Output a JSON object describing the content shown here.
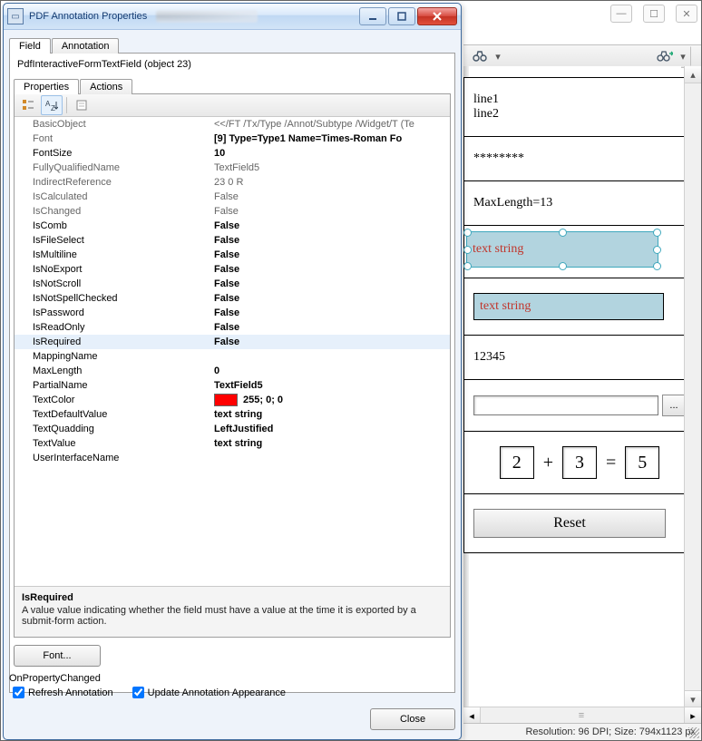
{
  "dialog": {
    "title": "PDF Annotation Properties",
    "tabs": {
      "field": "Field",
      "annotation": "Annotation"
    },
    "object_label": "PdfInteractiveFormTextField (object 23)",
    "inner_tabs": {
      "properties": "Properties",
      "actions": "Actions"
    },
    "props": {
      "BasicObject": {
        "k": "BasicObject",
        "v": "<</FT /Tx/Type /Annot/Subtype /Widget/T (Te",
        "bold": false
      },
      "Font": {
        "k": "Font",
        "v": "[9] Type=Type1 Name=Times-Roman Fo",
        "bold": true
      },
      "FontSize": {
        "k": "FontSize",
        "v": "10",
        "bold": true,
        "kbold": true
      },
      "FullyQualifiedName": {
        "k": "FullyQualifiedName",
        "v": "TextField5",
        "bold": false
      },
      "IndirectReference": {
        "k": "IndirectReference",
        "v": "23 0 R",
        "bold": false
      },
      "IsCalculated": {
        "k": "IsCalculated",
        "v": "False",
        "bold": false
      },
      "IsChanged": {
        "k": "IsChanged",
        "v": "False",
        "bold": false
      },
      "IsComb": {
        "k": "IsComb",
        "v": "False",
        "bold": true,
        "kbold": true
      },
      "IsFileSelect": {
        "k": "IsFileSelect",
        "v": "False",
        "bold": true,
        "kbold": true
      },
      "IsMultiline": {
        "k": "IsMultiline",
        "v": "False",
        "bold": true,
        "kbold": true
      },
      "IsNoExport": {
        "k": "IsNoExport",
        "v": "False",
        "bold": true,
        "kbold": true
      },
      "IsNotScroll": {
        "k": "IsNotScroll",
        "v": "False",
        "bold": true,
        "kbold": true
      },
      "IsNotSpellChecked": {
        "k": "IsNotSpellChecked",
        "v": "False",
        "bold": true,
        "kbold": true
      },
      "IsPassword": {
        "k": "IsPassword",
        "v": "False",
        "bold": true,
        "kbold": true
      },
      "IsReadOnly": {
        "k": "IsReadOnly",
        "v": "False",
        "bold": true,
        "kbold": true
      },
      "IsRequired": {
        "k": "IsRequired",
        "v": "False",
        "bold": true,
        "kbold": true,
        "selected": true
      },
      "MappingName": {
        "k": "MappingName",
        "v": "",
        "bold": true,
        "kbold": true
      },
      "MaxLength": {
        "k": "MaxLength",
        "v": "0",
        "bold": true,
        "kbold": true
      },
      "PartialName": {
        "k": "PartialName",
        "v": "TextField5",
        "bold": true,
        "kbold": true
      },
      "TextColor": {
        "k": "TextColor",
        "v": "255; 0; 0",
        "bold": true,
        "kbold": true,
        "swatch": "#ff0000"
      },
      "TextDefaultValue": {
        "k": "TextDefaultValue",
        "v": "text string",
        "bold": true,
        "kbold": true
      },
      "TextQuadding": {
        "k": "TextQuadding",
        "v": "LeftJustified",
        "bold": true,
        "kbold": true
      },
      "TextValue": {
        "k": "TextValue",
        "v": "text string",
        "bold": true,
        "kbold": true
      },
      "UserInterfaceName": {
        "k": "UserInterfaceName",
        "v": "",
        "bold": true,
        "kbold": true
      }
    },
    "prop_order": [
      "BasicObject",
      "Font",
      "FontSize",
      "FullyQualifiedName",
      "IndirectReference",
      "IsCalculated",
      "IsChanged",
      "IsComb",
      "IsFileSelect",
      "IsMultiline",
      "IsNoExport",
      "IsNotScroll",
      "IsNotSpellChecked",
      "IsPassword",
      "IsReadOnly",
      "IsRequired",
      "MappingName",
      "MaxLength",
      "PartialName",
      "TextColor",
      "TextDefaultValue",
      "TextQuadding",
      "TextValue",
      "UserInterfaceName"
    ],
    "desc": {
      "title": "IsRequired",
      "text": "A value value indicating whether the field must have a value at the time it is exported by a submit-form action."
    },
    "font_button": "Font...",
    "on_prop_changed": "OnPropertyChanged",
    "refresh_annotation": "Refresh Annotation",
    "update_annotation": "Update Annotation Appearance",
    "close_button": "Close"
  },
  "page": {
    "line1": "line1",
    "line2": "line2",
    "password": "********",
    "maxlen": "MaxLength=13",
    "selected_text": "text string",
    "rect_text": "text string",
    "number": "12345",
    "calc": {
      "a": "2",
      "b": "3",
      "c": "5",
      "plus": "+",
      "eq": "="
    },
    "reset": "Reset",
    "browse_dots": "..."
  },
  "status": {
    "text": "Resolution: 96 DPI; Size: 794x1123 px"
  }
}
